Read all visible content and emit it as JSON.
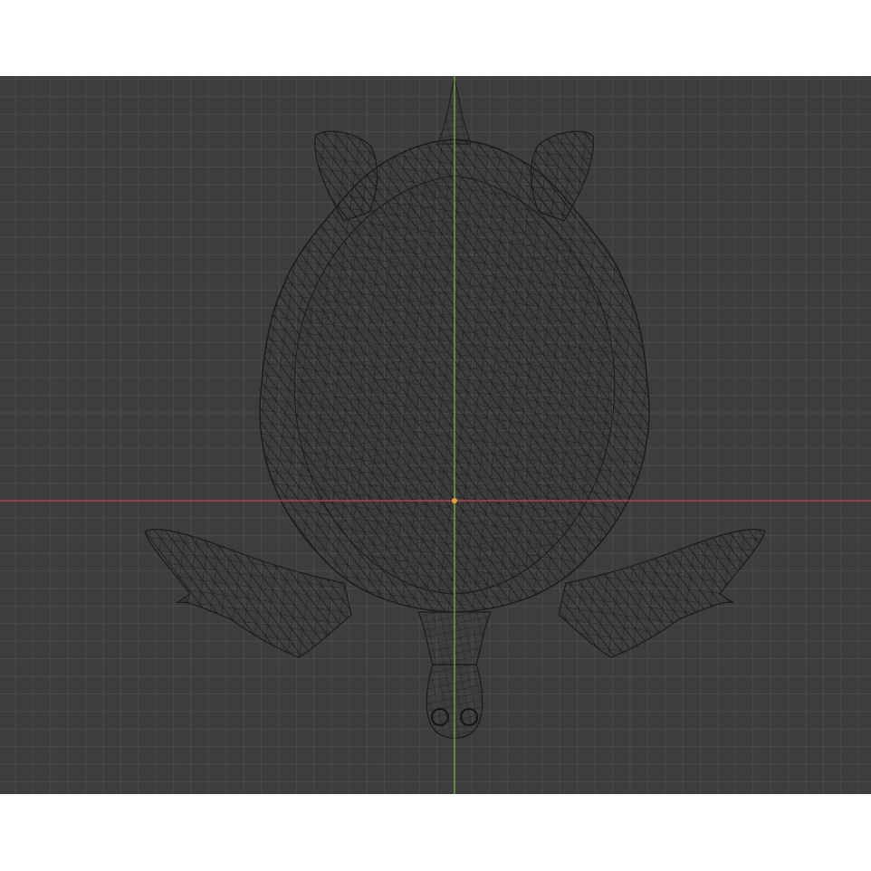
{
  "viewport": {
    "view": "top-orthographic",
    "shading": "wireframe",
    "model": "sea-turtle-mesh",
    "background_color": "#3d3d3d",
    "grid_color": "#4a4a4a",
    "wire_color": "#1c1c1c",
    "x_axis_color": "#c0454f",
    "y_axis_color": "#7db03a",
    "origin_marker_color": "#e8a13a"
  }
}
